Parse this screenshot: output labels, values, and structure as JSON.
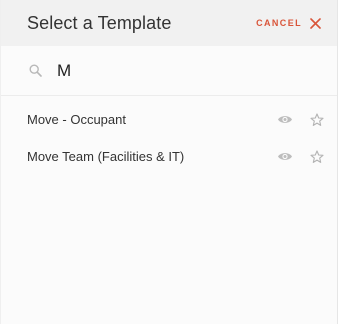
{
  "header": {
    "title": "Select a Template",
    "cancel_label": "CANCEL",
    "accent_color": "#d9553a"
  },
  "search": {
    "value": "M",
    "icon": "search-icon"
  },
  "templates": [
    {
      "label": "Move - Occupant",
      "preview_icon": "eye-icon",
      "favorite_icon": "star-icon"
    },
    {
      "label": "Move Team (Facilities & IT)",
      "preview_icon": "eye-icon",
      "favorite_icon": "star-icon"
    }
  ]
}
